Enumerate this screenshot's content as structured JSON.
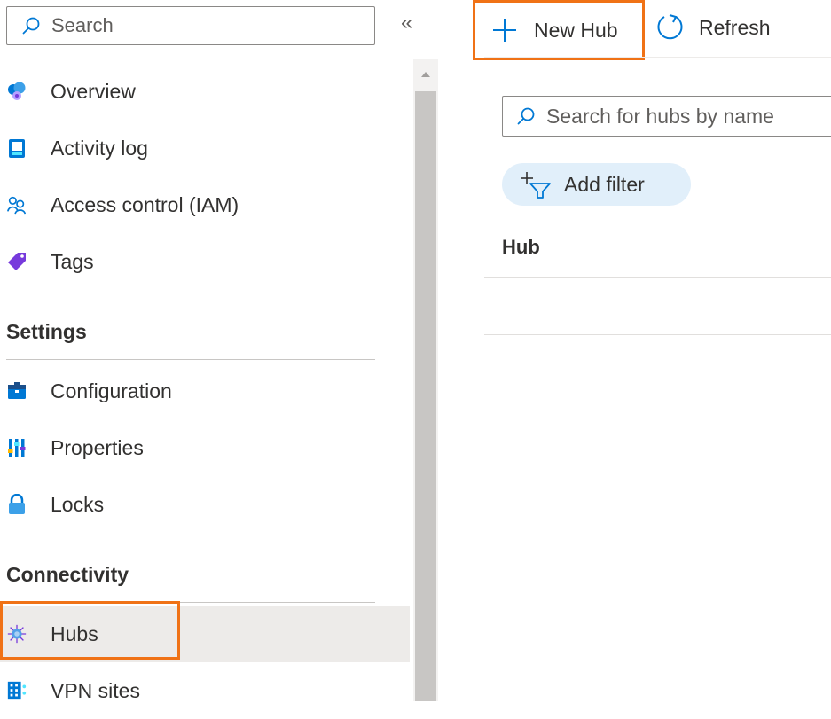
{
  "sidebar": {
    "search_placeholder": "Search",
    "collapse_glyph": "«",
    "items": [
      {
        "label": "Overview",
        "icon": "overview-icon"
      },
      {
        "label": "Activity log",
        "icon": "activity-log-icon"
      },
      {
        "label": "Access control (IAM)",
        "icon": "access-control-icon"
      },
      {
        "label": "Tags",
        "icon": "tag-icon"
      }
    ],
    "settings_heading": "Settings",
    "settings_items": [
      {
        "label": "Configuration",
        "icon": "configuration-icon"
      },
      {
        "label": "Properties",
        "icon": "properties-icon"
      },
      {
        "label": "Locks",
        "icon": "lock-icon"
      }
    ],
    "connectivity_heading": "Connectivity",
    "connectivity_items": [
      {
        "label": "Hubs",
        "icon": "hub-icon",
        "selected": true
      },
      {
        "label": "VPN sites",
        "icon": "vpn-sites-icon"
      }
    ]
  },
  "toolbar": {
    "new_hub_label": "New Hub",
    "refresh_label": "Refresh"
  },
  "main": {
    "search_placeholder": "Search for hubs by name",
    "add_filter_label": "Add filter",
    "column_header": "Hub"
  },
  "colors": {
    "highlight": "#f07216",
    "filter_pill": "#e1effa",
    "accent": "#0078d4",
    "selected_row": "#edebe9"
  }
}
